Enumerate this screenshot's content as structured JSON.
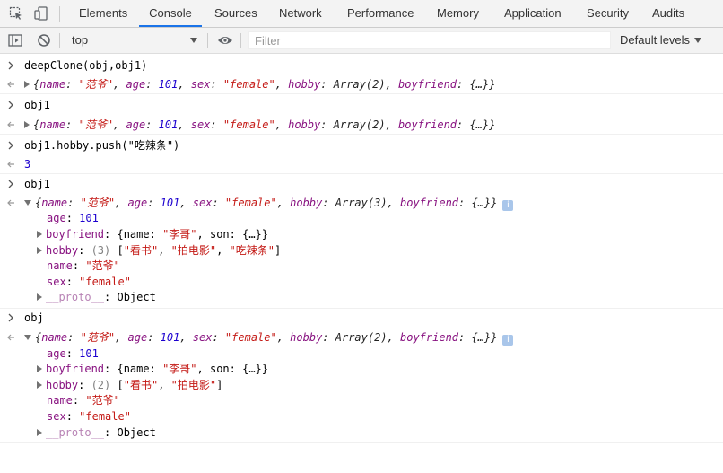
{
  "devtools": {
    "tabs": [
      {
        "label": "Elements"
      },
      {
        "label": "Console"
      },
      {
        "label": "Sources"
      },
      {
        "label": "Network"
      },
      {
        "label": "Performance"
      },
      {
        "label": "Memory"
      },
      {
        "label": "Application"
      },
      {
        "label": "Security"
      },
      {
        "label": "Audits"
      }
    ],
    "active_tab": "Console",
    "icons": [
      "inspect-element-icon",
      "device-toolbar-icon",
      "sidebar-toggle-icon",
      "clear-console-icon",
      "eye-icon",
      "info-icon"
    ],
    "accent_color": "#1a73e8"
  },
  "toolbar": {
    "context": "top",
    "filter_placeholder": "Filter",
    "levels": "Default levels"
  },
  "console": {
    "cmd1": "deepClone(obj,obj1)",
    "r1": {
      "open": "{",
      "k_name": "name",
      "colon1": ": ",
      "v_name": "\"范爷\"",
      "c1": ", ",
      "k_age": "age",
      "colon2": ": ",
      "v_age": "101",
      "c2": ", ",
      "k_sex": "sex",
      "colon3": ": ",
      "v_sex": "\"female\"",
      "c3": ", ",
      "k_hobby": "hobby",
      "colon4": ": ",
      "v_hobby": "Array(2)",
      "c4": ", ",
      "k_bf": "boyfriend",
      "colon5": ": ",
      "v_bf": "{…}",
      "close": "}"
    },
    "cmd2": "obj1",
    "r2": {
      "open": "{",
      "k_name": "name",
      "colon1": ": ",
      "v_name": "\"范爷\"",
      "c1": ", ",
      "k_age": "age",
      "colon2": ": ",
      "v_age": "101",
      "c2": ", ",
      "k_sex": "sex",
      "colon3": ": ",
      "v_sex": "\"female\"",
      "c3": ", ",
      "k_hobby": "hobby",
      "colon4": ": ",
      "v_hobby": "Array(2)",
      "c4": ", ",
      "k_bf": "boyfriend",
      "colon5": ": ",
      "v_bf": "{…}",
      "close": "}"
    },
    "cmd3_pre": "obj1.hobby.push(",
    "cmd3_arg": "\"吃辣条\"",
    "cmd3_post": ")",
    "r3": "3",
    "cmd4": "obj1",
    "r4": {
      "open": "{",
      "k_name": "name",
      "colon1": ": ",
      "v_name": "\"范爷\"",
      "c1": ", ",
      "k_age": "age",
      "colon2": ": ",
      "v_age": "101",
      "c2": ", ",
      "k_sex": "sex",
      "colon3": ": ",
      "v_sex": "\"female\"",
      "c3": ", ",
      "k_hobby": "hobby",
      "colon4": ": ",
      "v_hobby": "Array(3)",
      "c4": ", ",
      "k_bf": "boyfriend",
      "colon5": ": ",
      "v_bf": "{…}",
      "close": "}",
      "info": "i",
      "age_k": "age",
      "age_c": ": ",
      "age_v": "101",
      "bf_k": "boyfriend",
      "bf_c": ": ",
      "bf_open": "{name: ",
      "bf_name": "\"李哥\"",
      "bf_mid": ", son: ",
      "bf_son": "{…}",
      "bf_close": "}",
      "hobby_k": "hobby",
      "hobby_c": ": ",
      "hobby_len": "(3) ",
      "hobby_open": "[",
      "hobby_v1": "\"看书\"",
      "hobby_c1": ", ",
      "hobby_v2": "\"拍电影\"",
      "hobby_c2": ", ",
      "hobby_v3": "\"吃辣条\"",
      "hobby_close": "]",
      "name_k": "name",
      "name_c": ": ",
      "name_v": "\"范爷\"",
      "sex_k": "sex",
      "sex_c": ": ",
      "sex_v": "\"female\"",
      "proto_k": "__proto__",
      "proto_c": ": ",
      "proto_v": "Object"
    },
    "cmd5": "obj",
    "r5": {
      "open": "{",
      "k_name": "name",
      "colon1": ": ",
      "v_name": "\"范爷\"",
      "c1": ", ",
      "k_age": "age",
      "colon2": ": ",
      "v_age": "101",
      "c2": ", ",
      "k_sex": "sex",
      "colon3": ": ",
      "v_sex": "\"female\"",
      "c3": ", ",
      "k_hobby": "hobby",
      "colon4": ": ",
      "v_hobby": "Array(2)",
      "c4": ", ",
      "k_bf": "boyfriend",
      "colon5": ": ",
      "v_bf": "{…}",
      "close": "}",
      "info": "i",
      "age_k": "age",
      "age_c": ": ",
      "age_v": "101",
      "bf_k": "boyfriend",
      "bf_c": ": ",
      "bf_open": "{name: ",
      "bf_name": "\"李哥\"",
      "bf_mid": ", son: ",
      "bf_son": "{…}",
      "bf_close": "}",
      "hobby_k": "hobby",
      "hobby_c": ": ",
      "hobby_len": "(2) ",
      "hobby_open": "[",
      "hobby_v1": "\"看书\"",
      "hobby_c1": ", ",
      "hobby_v2": "\"拍电影\"",
      "hobby_close": "]",
      "name_k": "name",
      "name_c": ": ",
      "name_v": "\"范爷\"",
      "sex_k": "sex",
      "sex_c": ": ",
      "sex_v": "\"female\"",
      "proto_k": "__proto__",
      "proto_c": ": ",
      "proto_v": "Object"
    }
  }
}
